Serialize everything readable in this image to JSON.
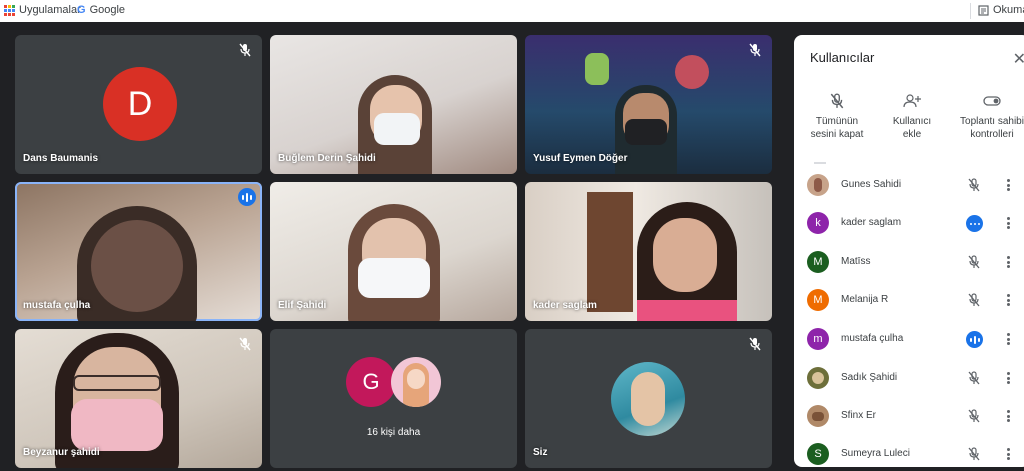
{
  "bookmarks": {
    "apps": "Uygulamalar",
    "google": "Google",
    "reading_list": "Okuma l"
  },
  "tiles": [
    {
      "name": "Dans Baumanis",
      "initial": "D",
      "muted": true
    },
    {
      "name": "Buğlem Derin Şahidi",
      "muted": false
    },
    {
      "name": "Yusuf Eymen Döğer",
      "muted": true
    },
    {
      "name": "mustafa çulha",
      "speaking": true
    },
    {
      "name": "Elif Şahidi",
      "muted": false
    },
    {
      "name": "kader saglam",
      "muted": false
    },
    {
      "name": "Beyzanur şahidi",
      "muted": true
    },
    {
      "more_label": "16 kişi daha",
      "initial": "G"
    },
    {
      "name": "Siz",
      "muted": true
    }
  ],
  "panel": {
    "title": "Kullanıcılar",
    "actions": [
      {
        "line1": "Tümünün",
        "line2": "sesini kapat"
      },
      {
        "line1": "Kullanıcı",
        "line2": "ekle"
      },
      {
        "line1": "Toplantı sahibi",
        "line2": "kontrolleri"
      }
    ],
    "participants": [
      {
        "name": "Gunes Sahidi",
        "initial": "",
        "color": "#c7a38a",
        "status": "muted"
      },
      {
        "name": "kader saglam",
        "initial": "k",
        "color": "#8e24aa",
        "status": "typing"
      },
      {
        "name": "Matīss",
        "initial": "M",
        "color": "#1b5e20",
        "status": "muted"
      },
      {
        "name": "Melanija R",
        "initial": "M",
        "color": "#ef6c00",
        "status": "muted"
      },
      {
        "name": "mustafa çulha",
        "initial": "m",
        "color": "#8e24aa",
        "status": "speaking"
      },
      {
        "name": "Sadık Şahidi",
        "initial": "",
        "color": "#6d6f3a",
        "status": "muted"
      },
      {
        "name": "Sfinx Er",
        "initial": "",
        "color": "#b08968",
        "status": "muted"
      },
      {
        "name": "Sumeyra Luleci",
        "initial": "S",
        "color": "#1b5e20",
        "status": "muted"
      }
    ]
  },
  "colors": {
    "accent": "#1a73e8",
    "stage": "#202124"
  }
}
